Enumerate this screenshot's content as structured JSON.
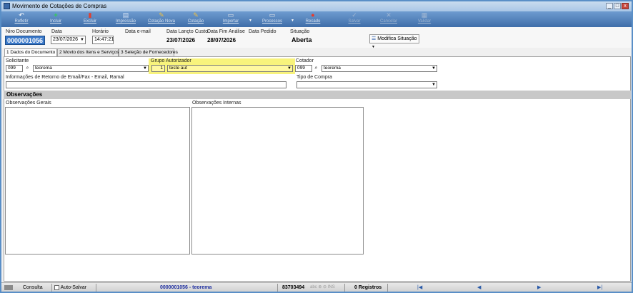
{
  "window": {
    "title": "Movimento de Cotações de Compras",
    "controls": [
      "_",
      "□",
      "x"
    ]
  },
  "toolbar": [
    {
      "label": "Refletir",
      "icon": "undo-icon",
      "disabled": false
    },
    {
      "label": "Incluir",
      "icon": "plus-icon",
      "disabled": false
    },
    {
      "label": "Excluir",
      "icon": "delete-icon",
      "disabled": false
    },
    {
      "label": "Impressão",
      "icon": "print-icon",
      "disabled": false
    },
    {
      "label": "Cotação Nova",
      "icon": "new-quote-icon",
      "disabled": false
    },
    {
      "label": "Cotação",
      "icon": "quote-icon",
      "disabled": false
    },
    {
      "label": "Importar",
      "icon": "import-icon",
      "disabled": false
    },
    {
      "label": "Processos",
      "icon": "process-icon",
      "disabled": false
    },
    {
      "label": "Recado",
      "icon": "message-icon",
      "disabled": false
    },
    {
      "label": "Salvar",
      "icon": "save-icon",
      "disabled": true
    },
    {
      "label": "Cancelar",
      "icon": "cancel-icon",
      "disabled": true
    },
    {
      "label": "Validar",
      "icon": "validate-icon",
      "disabled": true
    }
  ],
  "header": {
    "niro_label": "Niro Documento",
    "niro_value": "0000001056",
    "data_label": "Data",
    "data_value": "23/07/2026",
    "horario_label": "Horário",
    "horario_value": "14:47:21",
    "email_label": "Data e-mail",
    "lanco_label": "Data Lançto Custo",
    "lanco_value": "23/07/2026",
    "fim_label": "Data Fim Análise",
    "fim_value": "28/07/2026",
    "pedido_label": "Data Pedido",
    "situacao_label": "Situação",
    "situacao_value": "Aberta",
    "modifica_label": "Modifica Situação"
  },
  "tabs": [
    {
      "label": "1 Dados do Documento",
      "active": true
    },
    {
      "label": "2 Movto dos Itens e Serviços",
      "active": false
    },
    {
      "label": "3 Seleção de Fornecedores",
      "active": false
    }
  ],
  "form": {
    "solicitante_label": "Solicitante",
    "solicitante_code": "099",
    "solicitante_name": "teorema",
    "grupo_label": "Grupo Autorizador",
    "grupo_code": "1",
    "grupo_name": "teste aut",
    "cotador_label": "Cotador",
    "cotador_code": "099",
    "cotador_name": "teorema",
    "retorno_label": "Informações de Retorno de Email/Fax - Email, Ramal",
    "retorno_value": "",
    "tipo_label": "Tipo de Compra",
    "tipo_value": ""
  },
  "observacoes": {
    "section_title": "Observações",
    "gerais_label": "Observações Gerais",
    "internas_label": "Observações Internas"
  },
  "statusbar": {
    "consulta": "Consulta",
    "auto_salvar": "Auto-Salvar",
    "record": "0000001056 - teorema",
    "code": "83703494",
    "indicators": "abc  ⊕ ⊖  INS",
    "registros": "0 Registros",
    "nav": [
      "|◀",
      "◀",
      "▶",
      "▶|"
    ]
  }
}
